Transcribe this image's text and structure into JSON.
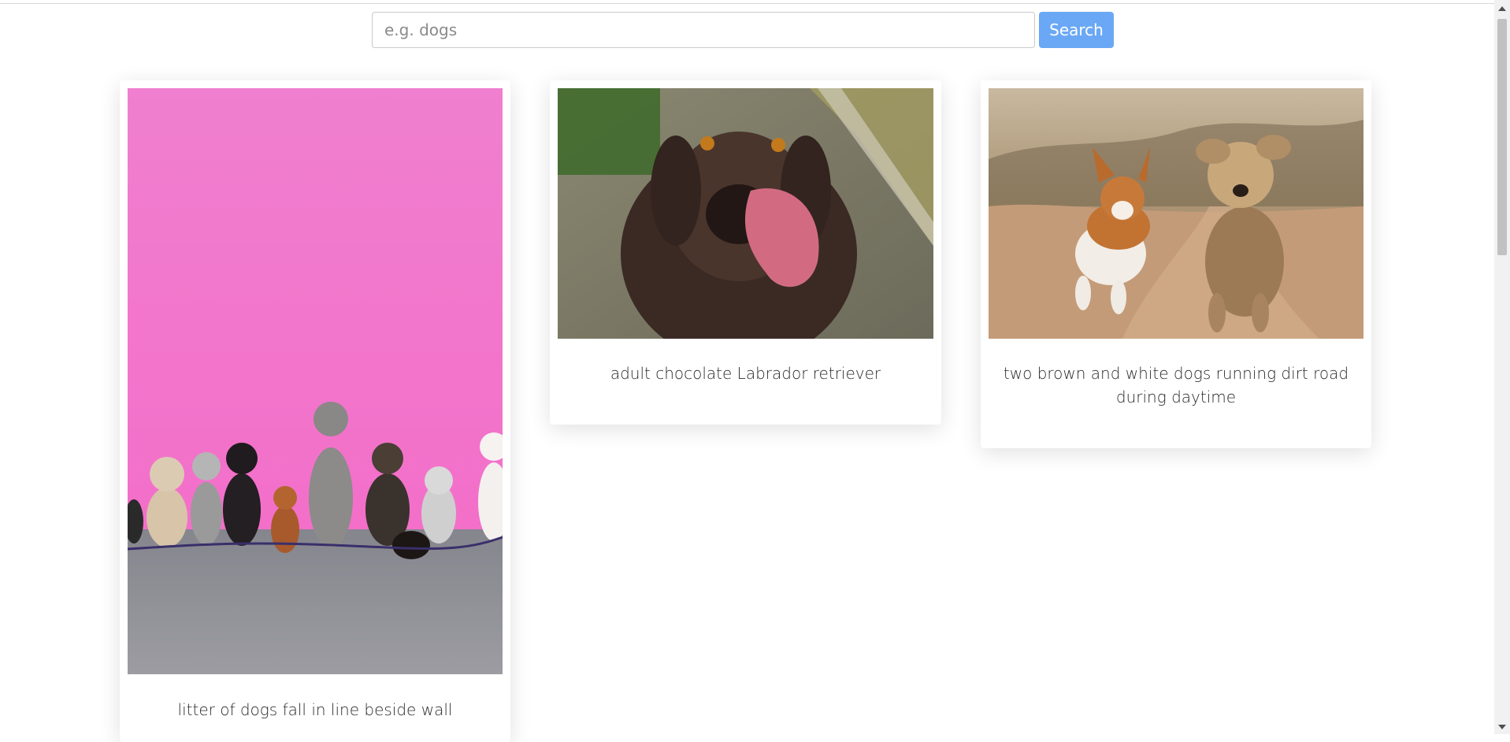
{
  "search": {
    "placeholder": "e.g. dogs",
    "value": "",
    "button_label": "Search"
  },
  "cards": [
    {
      "caption": "litter of dogs fall in line beside wall"
    },
    {
      "caption": "adult chocolate Labrador retriever"
    },
    {
      "caption": "two brown and white dogs running dirt road during daytime"
    }
  ],
  "colors": {
    "button": "#6aa8f5",
    "pink_wall": "#f27ccc"
  }
}
